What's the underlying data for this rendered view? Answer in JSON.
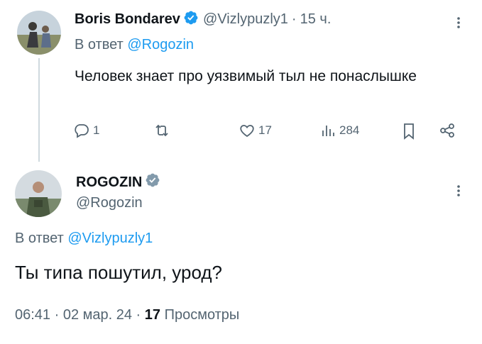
{
  "reply_tweet": {
    "author_name": "Boris Bondarev",
    "author_handle": "@Vizlypuzly1",
    "separator": "·",
    "time": "15 ч.",
    "replying_prefix": "В ответ",
    "replying_to": "@Rogozin",
    "text": "Человек знает про уязвимый тыл не понаслышке",
    "actions": {
      "replies": "1",
      "retweets": "",
      "likes": "17",
      "views": "284"
    }
  },
  "main_tweet": {
    "author_name": "ROGOZIN",
    "author_handle": "@Rogozin",
    "replying_prefix": "В ответ",
    "replying_to": "@Vizlypuzly1",
    "text": "Ты типа пошутил, урод?",
    "timestamp": "06:41 · 02 мар. 24 · ",
    "views_count": "17",
    "views_label": "Просмотры"
  },
  "colors": {
    "verified": "#1d9bf0",
    "verified_gray": "#829aab",
    "link": "#1d9bf0",
    "muted": "#536471"
  }
}
